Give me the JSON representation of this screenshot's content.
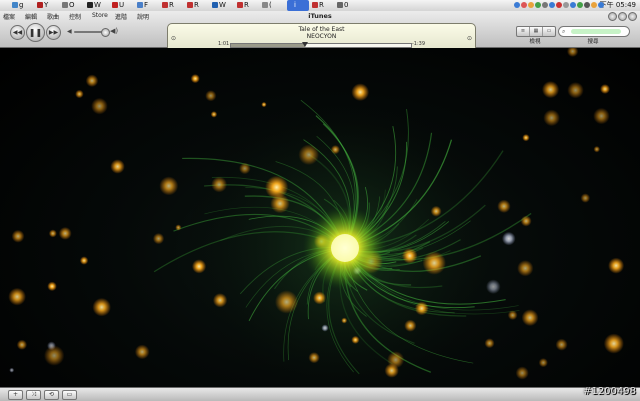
{
  "taskbar": {
    "tasks": [
      {
        "label": "g",
        "color": "#4285c8"
      },
      {
        "label": "Y",
        "color": "#b02020"
      },
      {
        "label": "O",
        "color": "#777777"
      },
      {
        "label": "W",
        "color": "#222222"
      },
      {
        "label": "U",
        "color": "#c02020"
      },
      {
        "label": "F",
        "color": "#4a7fc8"
      },
      {
        "label": "R",
        "color": "#c03030"
      },
      {
        "label": "R",
        "color": "#c03030"
      },
      {
        "label": "W",
        "color": "#2060b0"
      },
      {
        "label": "R",
        "color": "#c03030"
      },
      {
        "label": "(",
        "color": "#888888"
      },
      {
        "label": "i",
        "color": "#3b6fd6",
        "active": true
      },
      {
        "label": "R",
        "color": "#c03030"
      },
      {
        "label": "0",
        "color": "#666666"
      }
    ],
    "tray_colors": [
      "#3a7bd5",
      "#d55",
      "#e9a23b",
      "#43a047",
      "#777",
      "#3a7bd5",
      "#c33",
      "#999",
      "#3a7bd5",
      "#43a047",
      "#555",
      "#e9a23b",
      "#3a7bd5"
    ],
    "clock": "下午 05:49"
  },
  "itunes": {
    "window_title": "iTunes",
    "menu": [
      "檔案",
      "編輯",
      "歌曲",
      "控制",
      "Store",
      "進階",
      "說明"
    ],
    "transport": {
      "prev": "◀◀",
      "play": "❚❚",
      "next": "▶▶"
    },
    "volume": 0.82,
    "now_playing": {
      "title": "Tale of the East",
      "artist": "NEOCYON",
      "elapsed": "1:01",
      "remaining": "-1:39",
      "progress": 0.41
    },
    "view_label": "檢視",
    "search_label": "搜尋"
  },
  "bottom": {
    "buttons": [
      "+",
      "⤨",
      "⟲",
      "▭"
    ]
  },
  "watermark": "#1200498"
}
